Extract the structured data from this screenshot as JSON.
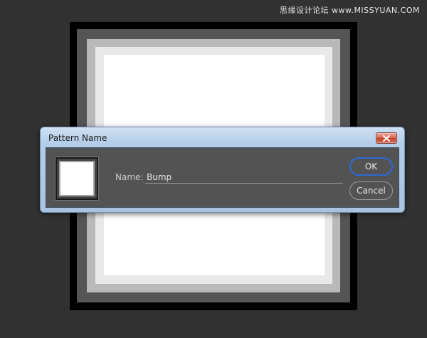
{
  "watermark": "思缘设计论坛 www.MISSYUAN.COM",
  "dialog": {
    "title": "Pattern Name",
    "close_icon": "close-icon",
    "name_label": "Name:",
    "name_value": "Bump",
    "ok_label": "OK",
    "cancel_label": "Cancel"
  },
  "colors": {
    "workspace_bg": "#323232",
    "dialog_client_bg": "#535353",
    "ok_focus_ring": "#2b6ad6",
    "close_button": "#c2412b"
  }
}
